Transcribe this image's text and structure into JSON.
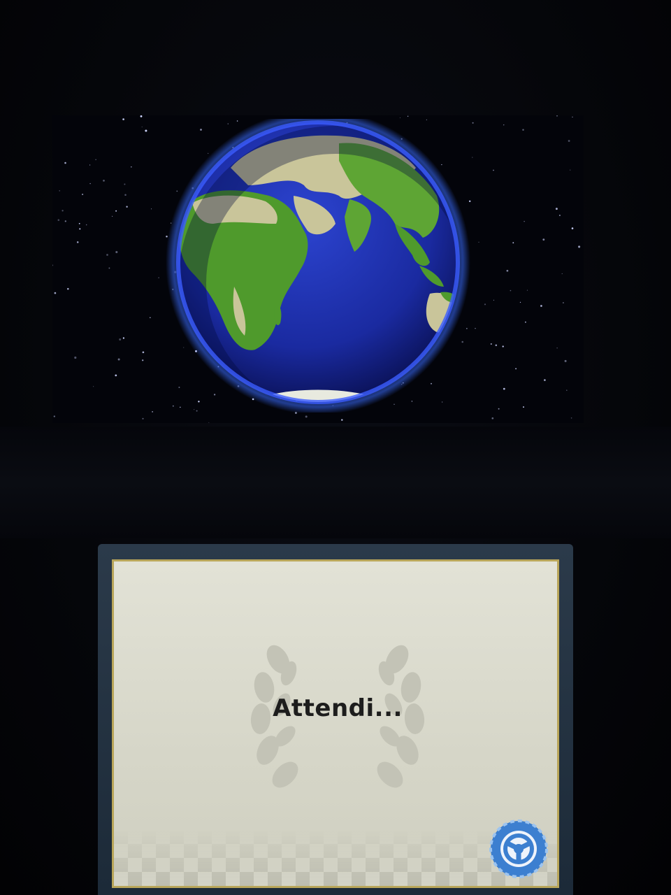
{
  "loading_screen": {
    "status_text": "Attendi..."
  },
  "icons": {
    "globe": "earth-globe-icon",
    "laurel": "laurel-wreath-icon",
    "wheel": "steering-wheel-icon"
  },
  "colors": {
    "ocean": "#1a2ea8",
    "land_green": "#4f9a2c",
    "land_tan": "#c9c59a",
    "screen_bg": "#dcdccf",
    "screen_border": "#b9a65a",
    "wheel_blue": "#3c7fd0",
    "text": "#1d1d1d"
  }
}
